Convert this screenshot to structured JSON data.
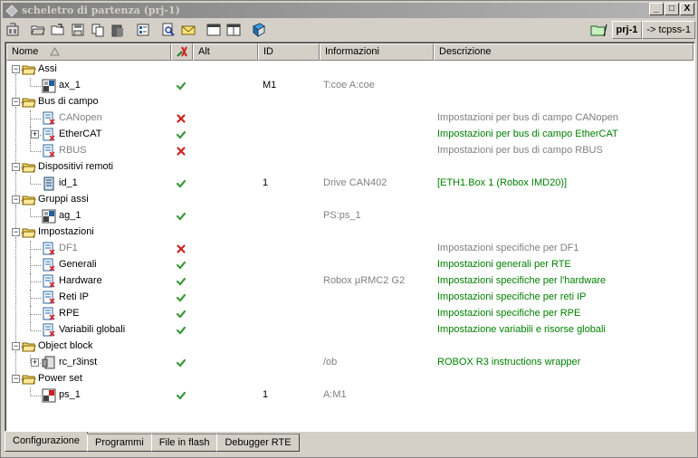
{
  "window": {
    "title": "scheletro di partenza (prj-1)",
    "controls": {
      "minimize": "_",
      "maximize": "□",
      "close": "X"
    }
  },
  "toolbar": {
    "project": "prj-1",
    "target": "-> tcpss-1",
    "buttons": [
      "project-settings-icon",
      "open-folder-icon",
      "open-folder-arrow-icon",
      "save-icon",
      "copy-icon",
      "paste-icon",
      "tree-icon",
      "find-icon",
      "mail-icon",
      "window-icon",
      "window2-icon",
      "book-icon"
    ]
  },
  "columns": {
    "nome": "Nome",
    "alt": "Alt",
    "id": "ID",
    "informazioni": "Informazioni",
    "descrizione": "Descrizione"
  },
  "rows": [
    {
      "name": "Assi",
      "type": "folder",
      "level": 0
    },
    {
      "name": "ax_1",
      "type": "axis",
      "level": 1,
      "status": "ok",
      "id": "M1",
      "info": "T:coe A:coe",
      "desc": ""
    },
    {
      "name": "Bus di campo",
      "type": "folder",
      "level": 0
    },
    {
      "name": "CANopen",
      "type": "page",
      "level": 1,
      "status": "error",
      "id": "",
      "info": "",
      "desc": "Impostazioni per bus di campo CANopen",
      "disabled": true
    },
    {
      "name": "EtherCAT",
      "type": "page",
      "level": 1,
      "status": "ok",
      "id": "",
      "info": "",
      "desc": "Impostazioni per bus di campo EtherCAT",
      "expandable": true
    },
    {
      "name": "RBUS",
      "type": "page",
      "level": 1,
      "status": "error",
      "id": "",
      "info": "",
      "desc": "Impostazioni per bus di campo RBUS",
      "disabled": true
    },
    {
      "name": "Dispositivi remoti",
      "type": "folder",
      "level": 0
    },
    {
      "name": "id_1",
      "type": "device",
      "level": 1,
      "status": "ok",
      "id": "1",
      "info": "Drive CAN402",
      "desc": "[ETH1.Box 1 (Robox IMD20)]"
    },
    {
      "name": "Gruppi assi",
      "type": "folder",
      "level": 0
    },
    {
      "name": "ag_1",
      "type": "axis",
      "level": 1,
      "status": "ok",
      "id": "",
      "info": "PS:ps_1",
      "desc": ""
    },
    {
      "name": "Impostazioni",
      "type": "folder",
      "level": 0
    },
    {
      "name": "DF1",
      "type": "page",
      "level": 1,
      "status": "error",
      "id": "",
      "info": "",
      "desc": "Impostazioni specifiche per DF1",
      "disabled": true
    },
    {
      "name": "Generali",
      "type": "page",
      "level": 1,
      "status": "ok",
      "id": "",
      "info": "",
      "desc": "Impostazioni generali per RTE"
    },
    {
      "name": "Hardware",
      "type": "page",
      "level": 1,
      "status": "ok",
      "id": "",
      "info": "Robox µRMC2 G2",
      "desc": "Impostazioni specifiche per l'hardware"
    },
    {
      "name": "Reti IP",
      "type": "page",
      "level": 1,
      "status": "ok",
      "id": "",
      "info": "",
      "desc": "Impostazioni specifiche per reti IP"
    },
    {
      "name": "RPE",
      "type": "page",
      "level": 1,
      "status": "ok",
      "id": "",
      "info": "",
      "desc": "Impostazioni specifiche per RPE"
    },
    {
      "name": "Variabili globali",
      "type": "page",
      "level": 1,
      "status": "ok",
      "id": "",
      "info": "",
      "desc": "Impostazione variabili e risorse globali"
    },
    {
      "name": "Object block",
      "type": "folder",
      "level": 0
    },
    {
      "name": "rc_r3inst",
      "type": "object",
      "level": 1,
      "status": "ok",
      "id": "",
      "info": "/ob",
      "desc": "ROBOX R3 instructions wrapper",
      "expandable": true
    },
    {
      "name": "Power set",
      "type": "folder",
      "level": 0
    },
    {
      "name": "ps_1",
      "type": "power",
      "level": 1,
      "status": "ok",
      "id": "1",
      "info": "A:M1",
      "desc": ""
    }
  ],
  "tabs": [
    "Configurazione",
    "Programmi",
    "File in flash",
    "Debugger RTE"
  ],
  "active_tab": 0,
  "colors": {
    "ok": "#3a9a3a",
    "error": "#d02020",
    "green_text": "#008000",
    "grey_text": "#808080",
    "folder": "#f5d76e"
  }
}
